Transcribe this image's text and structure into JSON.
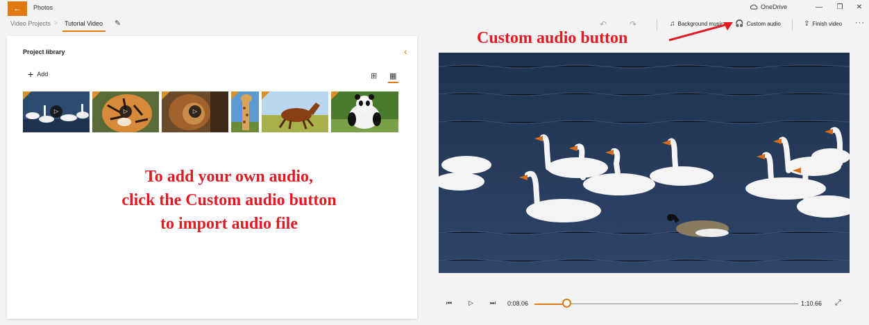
{
  "titlebar": {
    "back_icon": "←",
    "app_title": "Photos",
    "onedrive_label": "OneDrive",
    "minimize_icon": "—",
    "maximize_icon": "❐",
    "close_icon": "✕"
  },
  "breadcrumb": {
    "root": "Video Projects",
    "separator": ">",
    "current": "Tutorial Video",
    "rename_icon": "✎"
  },
  "toolbar": {
    "undo_icon": "↶",
    "redo_icon": "↷",
    "background_music": {
      "icon": "♫",
      "label": "Background music"
    },
    "custom_audio": {
      "icon": "🎧",
      "label": "Custom audio"
    },
    "finish_video": {
      "icon": "⇪",
      "label": "Finish video"
    },
    "more_icon": "···"
  },
  "library": {
    "title": "Project library",
    "collapse_icon": "‹",
    "add_label": "Add",
    "add_icon": "+",
    "view_large_icon": "⊞",
    "view_small_icon": "▦",
    "thumbnails": [
      {
        "name": "swans-video",
        "kind": "video"
      },
      {
        "name": "tiger-video",
        "kind": "video"
      },
      {
        "name": "lion-video",
        "kind": "video"
      },
      {
        "name": "giraffe-photo",
        "kind": "photo"
      },
      {
        "name": "horse-photo",
        "kind": "photo"
      },
      {
        "name": "panda-photo",
        "kind": "photo"
      }
    ]
  },
  "annotations": {
    "callout": "Custom audio button",
    "instruction_lines": [
      "To add your own audio,",
      "click the Custom audio button",
      "to import audio file"
    ]
  },
  "playback": {
    "rewind_icon": "⏮",
    "play_icon": "▷",
    "forward_icon": "⏭",
    "current_time": "0:08.06",
    "total_time": "1:10.66",
    "progress": 0.11,
    "fullscreen_icon": "⤢"
  },
  "colors": {
    "accent": "#e07a10",
    "annotation_red": "#e01b24",
    "water": "#2a3c5a"
  }
}
